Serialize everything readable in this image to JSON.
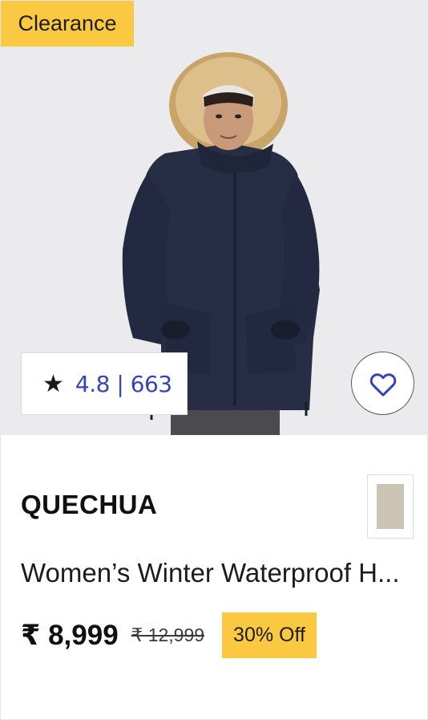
{
  "badge": {
    "label": "Clearance"
  },
  "rating": {
    "star": "★",
    "text": "4.8 | 663"
  },
  "wishlist": {
    "icon": "heart-outline-icon"
  },
  "product": {
    "brand": "QUECHUA",
    "title": "Women’s Winter Waterproof H...",
    "price": "₹ 8,999",
    "mrp": "₹ 12,999",
    "discount": "30% Off"
  },
  "swatch": {
    "color": "#cbc3b3"
  },
  "colors": {
    "badge_yellow": "#fbc941",
    "rating_blue": "#3643ba",
    "jacket_navy": "#272d44",
    "image_background": "#ebebed"
  }
}
